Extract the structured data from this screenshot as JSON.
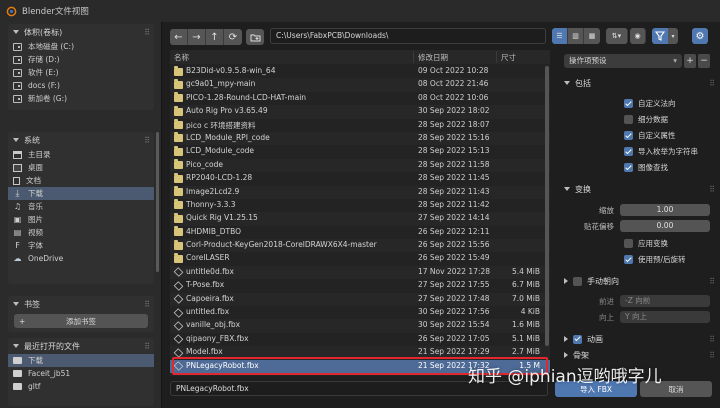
{
  "window": {
    "title": "Blender文件视图"
  },
  "sidebar": {
    "volumes": {
      "title": "体积(卷标)",
      "items": [
        {
          "label": "本地磁盘 (C:)",
          "icon": "drive-icon"
        },
        {
          "label": "存储 (D:)",
          "icon": "drive-icon"
        },
        {
          "label": "软件 (E:)",
          "icon": "drive-icon"
        },
        {
          "label": "docs (F:)",
          "icon": "drive-icon"
        },
        {
          "label": "新加卷 (G:)",
          "icon": "drive-icon"
        }
      ]
    },
    "system": {
      "title": "系统",
      "items": [
        {
          "label": "主目录",
          "icon": "home-icon",
          "selected": false
        },
        {
          "label": "桌面",
          "icon": "desktop-icon",
          "selected": false
        },
        {
          "label": "文档",
          "icon": "document-icon",
          "selected": false
        },
        {
          "label": "下载",
          "icon": "download-icon",
          "selected": true
        },
        {
          "label": "音乐",
          "icon": "music-icon",
          "selected": false
        },
        {
          "label": "图片",
          "icon": "image-icon",
          "selected": false
        },
        {
          "label": "视频",
          "icon": "video-icon",
          "selected": false
        },
        {
          "label": "字体",
          "icon": "font-icon",
          "selected": false
        },
        {
          "label": "OneDrive",
          "icon": "cloud-icon",
          "selected": false
        }
      ]
    },
    "bookmarks": {
      "title": "书签",
      "add_label": "添加书签"
    },
    "recent": {
      "title": "最近打开的文件",
      "items": [
        {
          "label": "下载",
          "selected": true
        },
        {
          "label": "Faceit_jb51",
          "selected": false
        },
        {
          "label": "gltf",
          "selected": false
        }
      ]
    }
  },
  "toolbar": {
    "back_icon": "←",
    "forward_icon": "→",
    "parent_icon": "↑",
    "refresh_icon": "⟳",
    "path": "C:\\Users\\FabxPCB\\Downloads\\"
  },
  "filelist": {
    "columns": {
      "name": "名称",
      "date": "修改日期",
      "size": "尺寸"
    },
    "rows": [
      {
        "name": "B23Did-v0.9.5.8-win_64",
        "date": "09 Oct 2022 10:28",
        "size": "",
        "type": "folder"
      },
      {
        "name": "gc9a01_mpy-main",
        "date": "08 Oct 2022 21:46",
        "size": "",
        "type": "folder"
      },
      {
        "name": "PICO-1.28-Round-LCD-HAT-main",
        "date": "08 Oct 2022 10:06",
        "size": "",
        "type": "folder"
      },
      {
        "name": "Auto Rig Pro v3.65.49",
        "date": "30 Sep 2022 18:02",
        "size": "",
        "type": "folder"
      },
      {
        "name": "pico c 环境搭建资料",
        "date": "28 Sep 2022 18:07",
        "size": "",
        "type": "folder"
      },
      {
        "name": "LCD_Module_RPI_code",
        "date": "28 Sep 2022 15:16",
        "size": "",
        "type": "folder"
      },
      {
        "name": "LCD_Module_code",
        "date": "28 Sep 2022 15:13",
        "size": "",
        "type": "folder"
      },
      {
        "name": "Pico_code",
        "date": "28 Sep 2022 11:58",
        "size": "",
        "type": "folder"
      },
      {
        "name": "RP2040-LCD-1.28",
        "date": "28 Sep 2022 11:45",
        "size": "",
        "type": "folder"
      },
      {
        "name": "Image2Lcd2.9",
        "date": "28 Sep 2022 11:43",
        "size": "",
        "type": "folder"
      },
      {
        "name": "Thonny-3.3.3",
        "date": "28 Sep 2022 11:42",
        "size": "",
        "type": "folder"
      },
      {
        "name": "Quick Rig V1.25.15",
        "date": "27 Sep 2022 14:14",
        "size": "",
        "type": "folder"
      },
      {
        "name": "4HDMIB_DTBO",
        "date": "26 Sep 2022 12:11",
        "size": "",
        "type": "folder"
      },
      {
        "name": "Corl-Product-KeyGen2018-CorelDRAWX6X4-master",
        "date": "26 Sep 2022 15:56",
        "size": "",
        "type": "folder"
      },
      {
        "name": "CorelLASER",
        "date": "26 Sep 2022 15:49",
        "size": "",
        "type": "folder"
      },
      {
        "name": "untitle0d.fbx",
        "date": "17 Nov 2022 17:28",
        "size": "5.4 MiB",
        "type": "fbx"
      },
      {
        "name": "T-Pose.fbx",
        "date": "27 Sep 2022 17:55",
        "size": "6.7 MiB",
        "type": "fbx"
      },
      {
        "name": "Capoeira.fbx",
        "date": "27 Sep 2022 17:48",
        "size": "7.0 MiB",
        "type": "fbx"
      },
      {
        "name": "untitled.fbx",
        "date": "30 Sep 2022 17:56",
        "size": "4 KiB",
        "type": "fbx"
      },
      {
        "name": "vanille_obj.fbx",
        "date": "30 Sep 2022 15:54",
        "size": "1.6 MiB",
        "type": "fbx"
      },
      {
        "name": "qipaony_FBX.fbx",
        "date": "26 Sep 2022 17:05",
        "size": "5.1 MiB",
        "type": "fbx"
      },
      {
        "name": "Model.fbx",
        "date": "21 Sep 2022 17:29",
        "size": "2.7 MiB",
        "type": "fbx"
      },
      {
        "name": "PNLegacyRobot.fbx",
        "date": "21 Sep 2022 17:32",
        "size": "1.5 M",
        "type": "fbx",
        "selected": true
      }
    ]
  },
  "filename": "PNLegacyRobot.fbx",
  "buttons": {
    "import": "导入 FBX",
    "cancel": "取消"
  },
  "operator": {
    "preset_label": "操作项预设",
    "include": {
      "title": "包括",
      "options": [
        {
          "label": "自定义法向",
          "checked": true
        },
        {
          "label": "细分数据",
          "checked": false
        },
        {
          "label": "自定义属性",
          "checked": true
        },
        {
          "label": "导入枚举为字符串",
          "checked": true
        },
        {
          "label": "图像查找",
          "checked": true
        }
      ]
    },
    "transform": {
      "title": "变换",
      "scale_label": "缩放",
      "scale_value": "1.00",
      "decal_label": "贴花偏移",
      "decal_value": "0.00",
      "apply_label": "应用变换",
      "apply_checked": false,
      "prepost_label": "使用预/后旋转",
      "prepost_checked": true
    },
    "manual": {
      "title": "手动朝向",
      "forward_label": "前进",
      "forward_value": "-Z 向前",
      "up_label": "向上",
      "up_value": "Y 向上"
    },
    "animation": {
      "title": "动画"
    },
    "armature": {
      "title": "骨架"
    }
  },
  "watermark": "知乎 @iphian逗哟哦字儿",
  "colors": {
    "accent": "#4f77b0",
    "highlight": "#e0282e",
    "folder": "#d8c57a"
  }
}
